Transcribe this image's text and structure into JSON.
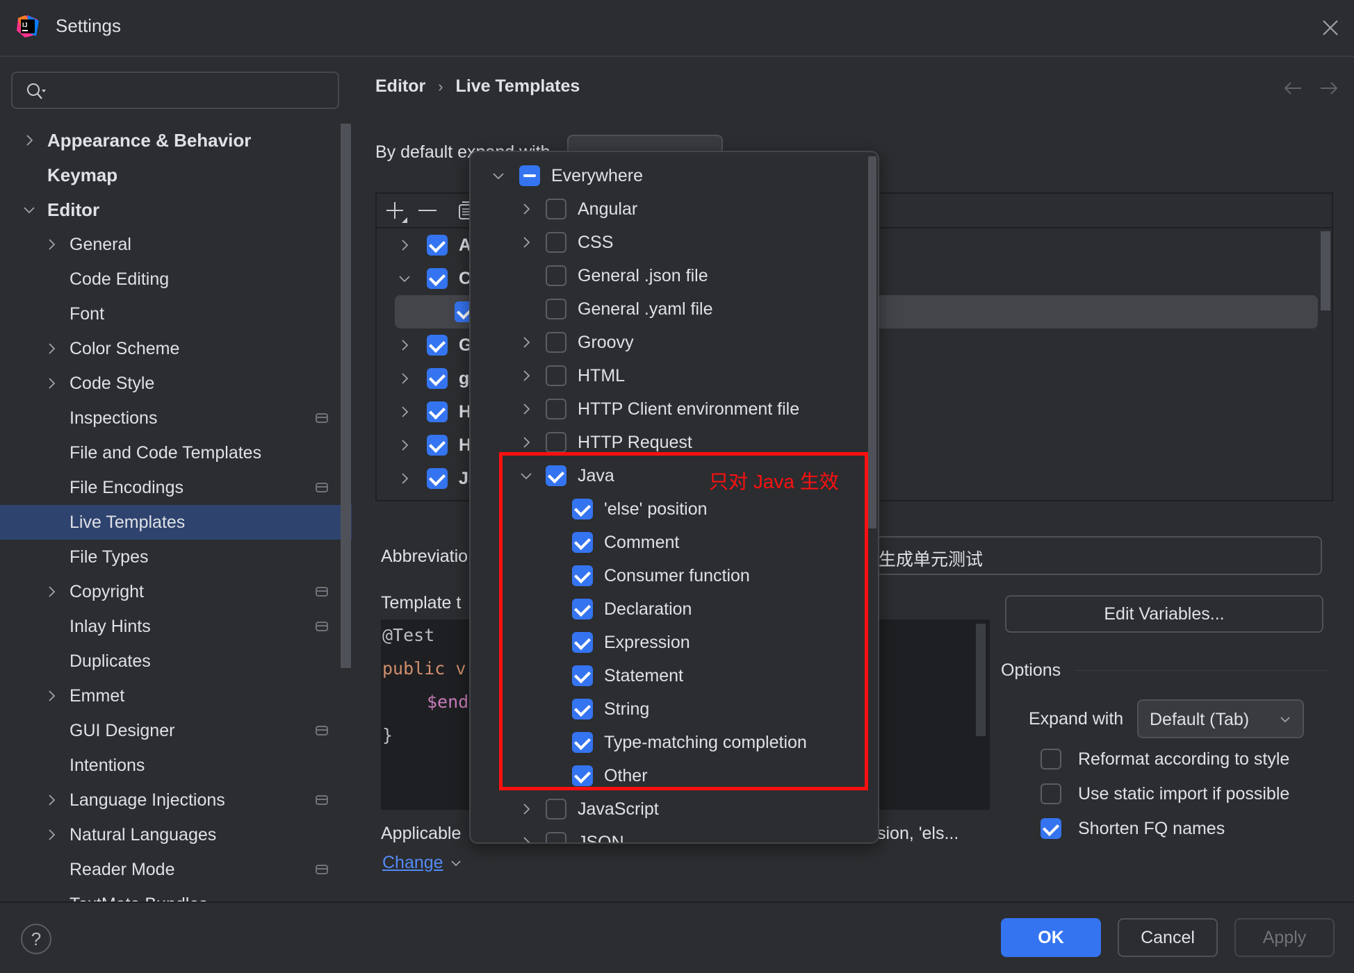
{
  "window": {
    "title": "Settings",
    "app_icon": "intellij-idea-icon"
  },
  "search": {
    "placeholder": "",
    "value": ""
  },
  "sidebar": {
    "items": [
      {
        "label": "Appearance & Behavior",
        "level": "top",
        "chevron": "right",
        "project_icon": false
      },
      {
        "label": "Keymap",
        "level": "top",
        "chevron": "none",
        "project_icon": false
      },
      {
        "label": "Editor",
        "level": "top",
        "chevron": "down",
        "project_icon": false
      },
      {
        "label": "General",
        "level": "sub",
        "chevron": "right",
        "project_icon": false
      },
      {
        "label": "Code Editing",
        "level": "sub",
        "chevron": "none",
        "project_icon": false
      },
      {
        "label": "Font",
        "level": "sub",
        "chevron": "none",
        "project_icon": false
      },
      {
        "label": "Color Scheme",
        "level": "sub",
        "chevron": "right",
        "project_icon": false
      },
      {
        "label": "Code Style",
        "level": "sub",
        "chevron": "right",
        "project_icon": false
      },
      {
        "label": "Inspections",
        "level": "sub",
        "chevron": "none",
        "project_icon": true
      },
      {
        "label": "File and Code Templates",
        "level": "sub",
        "chevron": "none",
        "project_icon": false
      },
      {
        "label": "File Encodings",
        "level": "sub",
        "chevron": "none",
        "project_icon": true
      },
      {
        "label": "Live Templates",
        "level": "sub",
        "chevron": "none",
        "project_icon": false,
        "selected": true
      },
      {
        "label": "File Types",
        "level": "sub",
        "chevron": "none",
        "project_icon": false
      },
      {
        "label": "Copyright",
        "level": "sub",
        "chevron": "right",
        "project_icon": true
      },
      {
        "label": "Inlay Hints",
        "level": "sub",
        "chevron": "none",
        "project_icon": true
      },
      {
        "label": "Duplicates",
        "level": "sub",
        "chevron": "none",
        "project_icon": false
      },
      {
        "label": "Emmet",
        "level": "sub",
        "chevron": "right",
        "project_icon": false
      },
      {
        "label": "GUI Designer",
        "level": "sub",
        "chevron": "none",
        "project_icon": true
      },
      {
        "label": "Intentions",
        "level": "sub",
        "chevron": "none",
        "project_icon": false
      },
      {
        "label": "Language Injections",
        "level": "sub",
        "chevron": "right",
        "project_icon": true
      },
      {
        "label": "Natural Languages",
        "level": "sub",
        "chevron": "right",
        "project_icon": false
      },
      {
        "label": "Reader Mode",
        "level": "sub",
        "chevron": "none",
        "project_icon": true
      },
      {
        "label": "TextMate Bundles",
        "level": "sub",
        "chevron": "none",
        "project_icon": false
      }
    ]
  },
  "breadcrumb": {
    "parent": "Editor",
    "separator": "›",
    "current": "Live Templates"
  },
  "main": {
    "expand_default_label": "By default expand with",
    "toolbar": [
      "add-icon",
      "remove-icon",
      "copy-icon"
    ],
    "template_groups": [
      {
        "name": "A",
        "checked": true,
        "chevron": "right"
      },
      {
        "name": "C",
        "checked": true,
        "chevron": "down"
      },
      {
        "name": "",
        "checked": true,
        "chevron": "none",
        "selected": true
      },
      {
        "name": "G",
        "checked": true,
        "chevron": "right"
      },
      {
        "name": "g",
        "checked": true,
        "chevron": "right"
      },
      {
        "name": "H",
        "checked": true,
        "chevron": "right"
      },
      {
        "name": "H",
        "checked": true,
        "chevron": "right"
      },
      {
        "name": "Ja",
        "checked": true,
        "chevron": "right"
      }
    ],
    "abbreviation_label": "Abbreviatio",
    "description_value": "生成单元测试",
    "template_text_label": "Template t",
    "code_lines": [
      {
        "text": "@Test",
        "color": "#bcbec4",
        "indent": 0
      },
      {
        "text": "public v",
        "color": "#cf8e6d",
        "indent": 0
      },
      {
        "text": "$end",
        "color": "#c77dbb",
        "indent": 2
      },
      {
        "text": "}",
        "color": "#bcbec4",
        "indent": 0
      }
    ],
    "edit_variables_label": "Edit Variables...",
    "options_label": "Options",
    "expand_with_label": "Expand with",
    "expand_with_value": "Default (Tab)",
    "options": [
      {
        "label": "Reformat according to style",
        "checked": false
      },
      {
        "label": "Use static import if possible",
        "checked": false
      },
      {
        "label": "Shorten FQ names",
        "checked": true
      }
    ],
    "applicable_label": "Applicable",
    "applicable_tail": "sion, 'els...",
    "change_link": "Change"
  },
  "context_popup": {
    "rows": [
      {
        "label": "Everywhere",
        "state": "partial",
        "chevron": "down",
        "level": 0
      },
      {
        "label": "Angular",
        "state": "off",
        "chevron": "right",
        "level": 1
      },
      {
        "label": "CSS",
        "state": "off",
        "chevron": "right",
        "level": 1
      },
      {
        "label": "General .json file",
        "state": "off",
        "chevron": "none",
        "level": 1
      },
      {
        "label": "General .yaml file",
        "state": "off",
        "chevron": "none",
        "level": 1
      },
      {
        "label": "Groovy",
        "state": "off",
        "chevron": "right",
        "level": 1
      },
      {
        "label": "HTML",
        "state": "off",
        "chevron": "right",
        "level": 1
      },
      {
        "label": "HTTP Client environment file",
        "state": "off",
        "chevron": "right",
        "level": 1
      },
      {
        "label": "HTTP Request",
        "state": "off",
        "chevron": "right",
        "level": 1
      },
      {
        "label": "Java",
        "state": "on",
        "chevron": "down",
        "level": 1
      },
      {
        "label": "'else' position",
        "state": "on",
        "chevron": "none",
        "level": 2
      },
      {
        "label": "Comment",
        "state": "on",
        "chevron": "none",
        "level": 2
      },
      {
        "label": "Consumer function",
        "state": "on",
        "chevron": "none",
        "level": 2
      },
      {
        "label": "Declaration",
        "state": "on",
        "chevron": "none",
        "level": 2
      },
      {
        "label": "Expression",
        "state": "on",
        "chevron": "none",
        "level": 2
      },
      {
        "label": "Statement",
        "state": "on",
        "chevron": "none",
        "level": 2
      },
      {
        "label": "String",
        "state": "on",
        "chevron": "none",
        "level": 2
      },
      {
        "label": "Type-matching completion",
        "state": "on",
        "chevron": "none",
        "level": 2
      },
      {
        "label": "Other",
        "state": "on",
        "chevron": "none",
        "level": 2
      },
      {
        "label": "JavaScript",
        "state": "off",
        "chevron": "right",
        "level": 1
      },
      {
        "label": "JSON",
        "state": "off",
        "chevron": "right",
        "level": 1
      }
    ],
    "annotation": "只对 Java 生效",
    "annotation_color": "#ff1010"
  },
  "footer": {
    "help_label": "?",
    "ok_label": "OK",
    "cancel_label": "Cancel",
    "apply_label": "Apply"
  },
  "colors": {
    "accent": "#3574f0",
    "background": "#2b2d30",
    "selection": "#2e436e",
    "link": "#548af7"
  }
}
